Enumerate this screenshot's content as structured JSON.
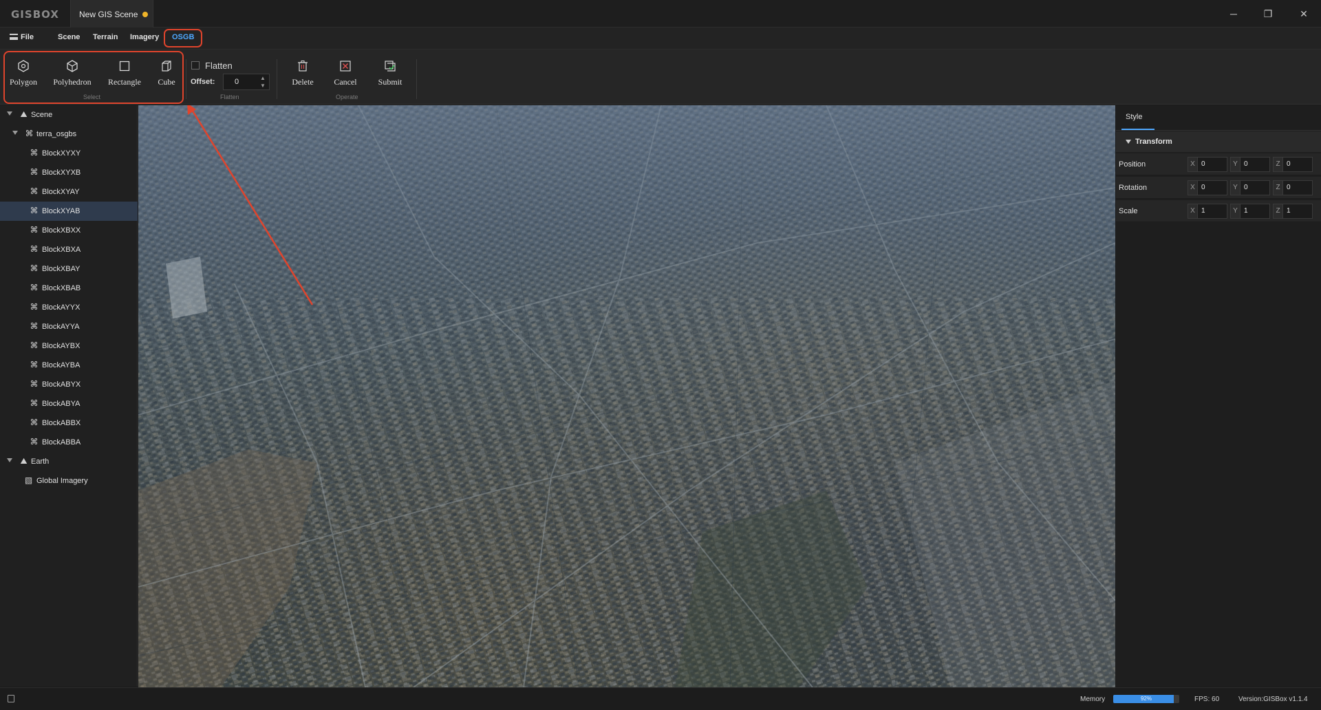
{
  "app": {
    "logo": "GISBOX",
    "document_tab": "New GIS Scene"
  },
  "window_controls": {
    "minimize": "─",
    "maximize": "❐",
    "close": "✕"
  },
  "menu": {
    "file": "File",
    "scene": "Scene",
    "terrain": "Terrain",
    "imagery": "Imagery",
    "osgb": "OSGB",
    "active": "OSGB"
  },
  "ribbon": {
    "select_group": {
      "label": "Select",
      "buttons": [
        {
          "label": "Polygon",
          "icon": "polygon-icon"
        },
        {
          "label": "Polyhedron",
          "icon": "polyhedron-icon"
        },
        {
          "label": "Rectangle",
          "icon": "rectangle-icon"
        },
        {
          "label": "Cube",
          "icon": "cube-icon"
        }
      ]
    },
    "flatten_group": {
      "label": "Flatten",
      "checkbox_label": "Flatten",
      "checked": false,
      "offset_label": "Offset:",
      "offset_value": "0"
    },
    "operate_group": {
      "label": "Operate",
      "buttons": [
        {
          "label": "Delete",
          "icon": "trash-icon"
        },
        {
          "label": "Cancel",
          "icon": "cancel-icon"
        },
        {
          "label": "Submit",
          "icon": "submit-icon"
        }
      ]
    }
  },
  "tree": {
    "scene": "Scene",
    "terra": "terra_osgbs",
    "blocks": [
      "BlockXYXY",
      "BlockXYXB",
      "BlockXYAY",
      "BlockXYAB",
      "BlockXBXX",
      "BlockXBXA",
      "BlockXBAY",
      "BlockXBAB",
      "BlockAYYX",
      "BlockAYYA",
      "BlockAYBX",
      "BlockAYBA",
      "BlockABYX",
      "BlockABYA",
      "BlockABBX",
      "BlockABBA"
    ],
    "selected": "BlockXYAB",
    "earth": "Earth",
    "global_imagery": "Global Imagery"
  },
  "style_panel": {
    "tab": "Style",
    "section": "Transform",
    "rows": [
      {
        "label": "Position",
        "x": "0",
        "y": "0",
        "z": "0"
      },
      {
        "label": "Rotation",
        "x": "0",
        "y": "0",
        "z": "0"
      },
      {
        "label": "Scale",
        "x": "1",
        "y": "1",
        "z": "1"
      }
    ],
    "axis_tags": {
      "x": "X",
      "y": "Y",
      "z": "Z"
    }
  },
  "status": {
    "memory_label": "Memory",
    "memory_percent": 92,
    "memory_text": "92%",
    "fps": "FPS: 60",
    "version": "Version:GISBox v1.1.4"
  },
  "colors": {
    "accent": "#4ea8ff",
    "highlight": "#e0442c",
    "unsaved": "#f0b429"
  }
}
